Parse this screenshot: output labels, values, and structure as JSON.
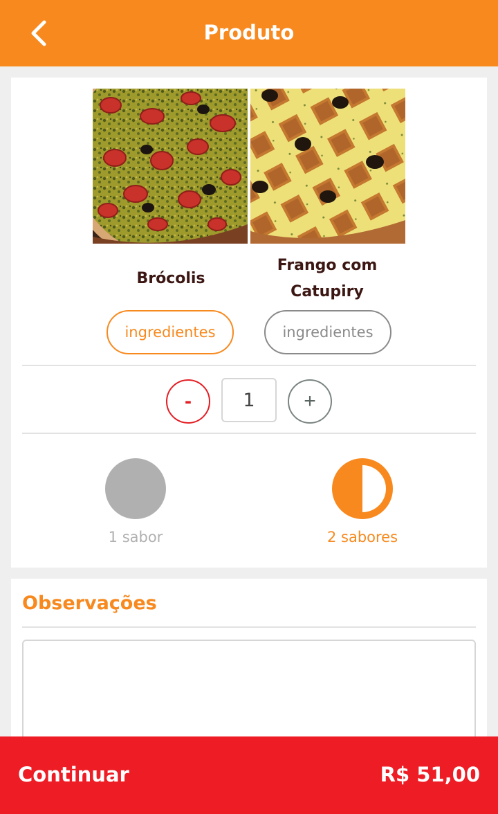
{
  "header": {
    "title": "Produto",
    "back_icon": "chevron-left-icon",
    "background": "#f7891e"
  },
  "flavors": [
    {
      "name": "Brócolis",
      "ingredients_label": "ingredientes",
      "selected": true,
      "image": "pizza-brocolis-image"
    },
    {
      "name": "Frango com Catupiry",
      "ingredients_label": "ingredientes",
      "selected": false,
      "image": "pizza-frango-catupiry-image"
    }
  ],
  "quantity": {
    "minus_label": "-",
    "value": "1",
    "plus_label": "+"
  },
  "sabores": {
    "options": [
      {
        "label": "1 sabor",
        "selected": false,
        "icon": "full-circle-icon"
      },
      {
        "label": "2 sabores",
        "selected": true,
        "icon": "half-circle-icon"
      }
    ]
  },
  "observacoes": {
    "title": "Observações",
    "value": ""
  },
  "footer": {
    "continue_label": "Continuar",
    "price": "R$ 51,00",
    "background": "#ee1c24"
  },
  "colors": {
    "accent": "#f7891e",
    "danger": "#ee1c24",
    "muted": "#b0b0b0",
    "text_dark": "#3b1612"
  }
}
